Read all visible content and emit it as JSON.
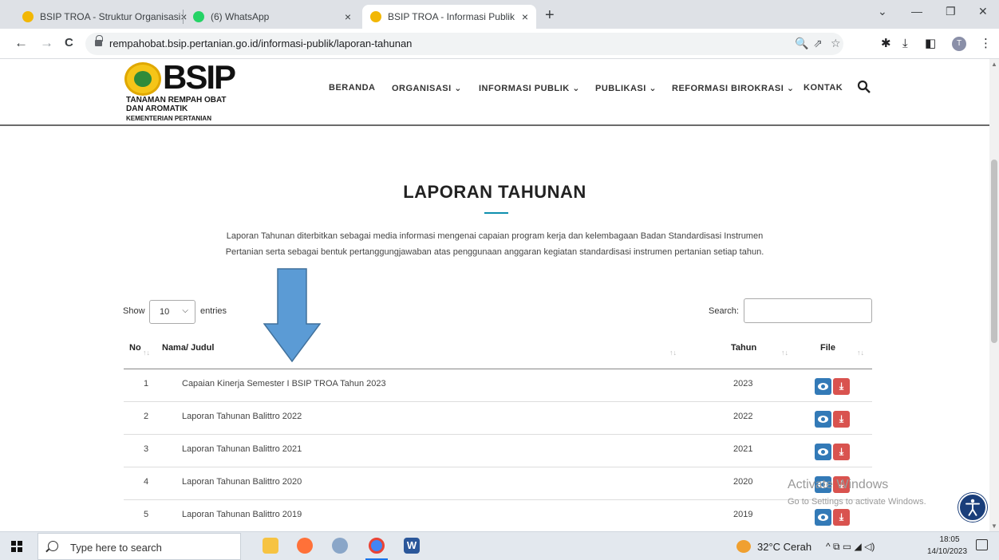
{
  "browser": {
    "tabs": [
      {
        "title": "BSIP TROA - Struktur Organisasi",
        "close": "×",
        "active": false
      },
      {
        "title": "(6) WhatsApp",
        "close": "×",
        "active": false
      },
      {
        "title": "BSIP TROA - Informasi Publik",
        "close": "×",
        "active": true
      }
    ],
    "new_tab": "+",
    "window_controls": {
      "dropdown": "⌄",
      "minimize": "—",
      "restore": "❐",
      "close": "✕"
    },
    "nav": {
      "back": "←",
      "forward": "→",
      "reload": "C"
    },
    "url": "rempahobat.bsip.pertanian.go.id/informasi-publik/laporan-tahunan",
    "profile_initial": "T",
    "toolbar_icons": [
      "zoom-icon",
      "share-icon",
      "bookmark-star-icon",
      "extensions-icon",
      "download-icon",
      "sidepanel-icon",
      "profile-icon",
      "menu-icon"
    ],
    "toolbar_glyphs": {
      "zoom": "🔍",
      "share": "⇗",
      "star": "☆",
      "extensions": "✱",
      "download": "⤓",
      "sidepanel": "◧",
      "menu": "⋮"
    }
  },
  "site": {
    "logo": {
      "wordmark": "BSIP",
      "line1": "TANAMAN REMPAH OBAT",
      "line2": "DAN AROMATIK",
      "line3": "KEMENTERIAN PERTANIAN"
    },
    "nav": [
      {
        "label": "BERANDA"
      },
      {
        "label": "ORGANISASI ⌄"
      },
      {
        "label": "INFORMASI PUBLIK ⌄"
      },
      {
        "label": "PUBLIKASI ⌄"
      },
      {
        "label": "REFORMASI BIROKRASI ⌄"
      },
      {
        "label": "KONTAK"
      }
    ]
  },
  "content": {
    "title": "LAPORAN TAHUNAN",
    "description_line1": "Laporan Tahunan diterbitkan sebagai media informasi mengenai capaian program kerja dan kelembagaan Badan Standardisasi Instrumen",
    "description_line2": "Pertanian serta sebagai bentuk pertanggungjawaban atas penggunaan anggaran kegiatan standardisasi instrumen pertanian setiap tahun.",
    "show_label": "Show",
    "entries_value": "10",
    "entries_label": "entries",
    "search_label": "Search:",
    "search_value": "",
    "columns": {
      "no": "No",
      "judul": "Nama/ Judul",
      "tahun": "Tahun",
      "file": "File"
    },
    "sort_glyph": "↑↓",
    "rows": [
      {
        "no": "1",
        "judul": "Capaian Kinerja Semester I BSIP TROA Tahun 2023",
        "tahun": "2023"
      },
      {
        "no": "2",
        "judul": "Laporan Tahunan Balittro 2022",
        "tahun": "2022"
      },
      {
        "no": "3",
        "judul": "Laporan Tahunan Balittro 2021",
        "tahun": "2021"
      },
      {
        "no": "4",
        "judul": "Laporan Tahunan Balittro 2020",
        "tahun": "2020"
      },
      {
        "no": "5",
        "judul": "Laporan Tahunan Balittro 2019",
        "tahun": "2019"
      }
    ],
    "download_glyph": "⤓"
  },
  "overlay": {
    "watermark_line1": "Activate Windows",
    "watermark_line2": "Go to Settings to activate Windows.",
    "annotation_arrow_color": "#5b9bd5"
  },
  "taskbar": {
    "search_placeholder": "Type here to search",
    "weather": "32°C  Cerah",
    "tray_glyphs": "^  ⧉  ▭  ◢  ◁)",
    "time": "18:05",
    "date": "14/10/2023"
  },
  "colors": {
    "accent_rule": "#0e8fae",
    "view_button": "#337ab7",
    "download_button": "#d9534f"
  }
}
